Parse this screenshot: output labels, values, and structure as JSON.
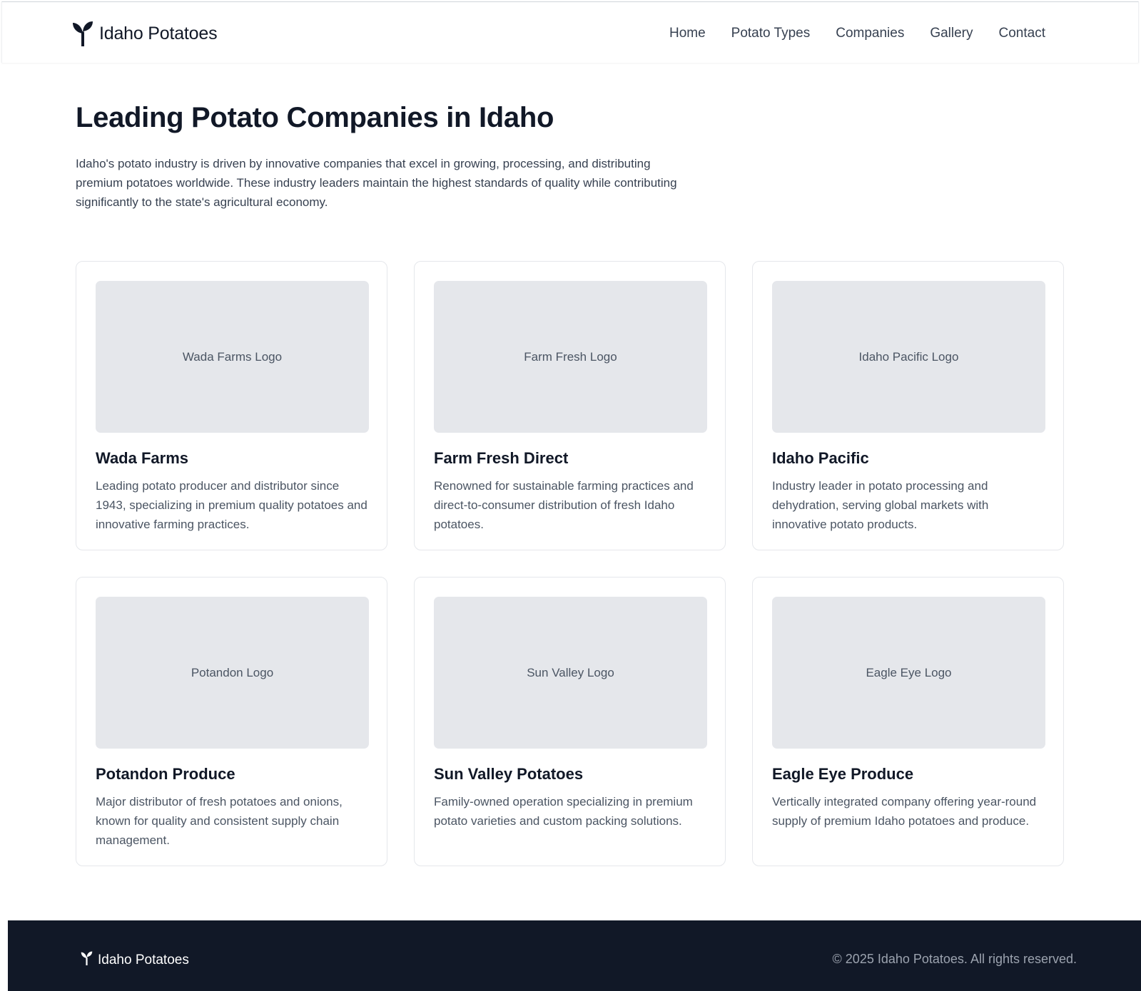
{
  "header": {
    "brand": "Idaho Potatoes",
    "nav": [
      "Home",
      "Potato Types",
      "Companies",
      "Gallery",
      "Contact"
    ]
  },
  "main": {
    "title": "Leading Potato Companies in Idaho",
    "intro": "Idaho's potato industry is driven by innovative companies that excel in growing, processing, and distributing premium potatoes worldwide. These industry leaders maintain the highest standards of quality while contributing significantly to the state's agricultural economy."
  },
  "companies": [
    {
      "logo": "Wada Farms Logo",
      "name": "Wada Farms",
      "desc": "Leading potato producer and distributor since 1943, specializing in premium quality potatoes and innovative farming practices."
    },
    {
      "logo": "Farm Fresh Logo",
      "name": "Farm Fresh Direct",
      "desc": "Renowned for sustainable farming practices and direct-to-consumer distribution of fresh Idaho potatoes."
    },
    {
      "logo": "Idaho Pacific Logo",
      "name": "Idaho Pacific",
      "desc": "Industry leader in potato processing and dehydration, serving global markets with innovative potato products."
    },
    {
      "logo": "Potandon Logo",
      "name": "Potandon Produce",
      "desc": "Major distributor of fresh potatoes and onions, known for quality and consistent supply chain management."
    },
    {
      "logo": "Sun Valley Logo",
      "name": "Sun Valley Potatoes",
      "desc": "Family-owned operation specializing in premium potato varieties and custom packing solutions."
    },
    {
      "logo": "Eagle Eye Logo",
      "name": "Eagle Eye Produce",
      "desc": "Vertically integrated company offering year-round supply of premium Idaho potatoes and produce."
    }
  ],
  "footer": {
    "brand": "Idaho Potatoes",
    "copyright": "© 2025 Idaho Potatoes. All rights reserved."
  },
  "colors": {
    "text": "#111827",
    "footer_bg": "#111827",
    "placeholder_bg": "#e5e7eb"
  },
  "icons": {
    "brand": "sprout-icon"
  }
}
